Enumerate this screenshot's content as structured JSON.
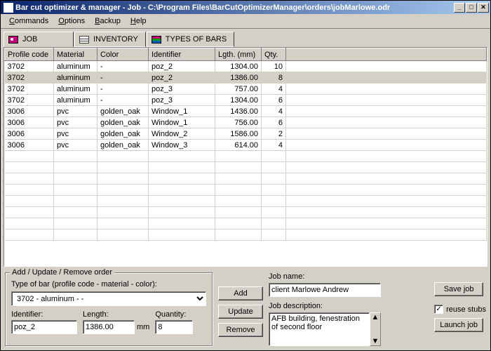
{
  "window": {
    "title": "Bar cut optimizer & manager - Job - C:\\Program Files\\BarCutOptimizerManager\\orders\\jobMarlowe.odr"
  },
  "menu": {
    "commands": "Commands",
    "options": "Options",
    "backup": "Backup",
    "help": "Help"
  },
  "tabs": {
    "job": "JOB",
    "inventory": "INVENTORY",
    "types": "TYPES OF BARS"
  },
  "grid": {
    "headers": {
      "profile": "Profile code",
      "material": "Material",
      "color": "Color",
      "identifier": "Identifier",
      "length": "Lgth. (mm)",
      "qty": "Qty."
    },
    "rows": [
      {
        "profile": "3702",
        "material": "aluminum",
        "color": "-",
        "identifier": "poz_2",
        "length": "1304.00",
        "qty": "10",
        "selected": false
      },
      {
        "profile": "3702",
        "material": "aluminum",
        "color": "-",
        "identifier": "poz_2",
        "length": "1386.00",
        "qty": "8",
        "selected": true
      },
      {
        "profile": "3702",
        "material": "aluminum",
        "color": "-",
        "identifier": "poz_3",
        "length": "757.00",
        "qty": "4",
        "selected": false
      },
      {
        "profile": "3702",
        "material": "aluminum",
        "color": "-",
        "identifier": "poz_3",
        "length": "1304.00",
        "qty": "6",
        "selected": false
      },
      {
        "profile": "3006",
        "material": "pvc",
        "color": "golden_oak",
        "identifier": "Window_1",
        "length": "1436.00",
        "qty": "4",
        "selected": false
      },
      {
        "profile": "3006",
        "material": "pvc",
        "color": "golden_oak",
        "identifier": "Window_1",
        "length": "756.00",
        "qty": "6",
        "selected": false
      },
      {
        "profile": "3006",
        "material": "pvc",
        "color": "golden_oak",
        "identifier": "Window_2",
        "length": "1586.00",
        "qty": "2",
        "selected": false
      },
      {
        "profile": "3006",
        "material": "pvc",
        "color": "golden_oak",
        "identifier": "Window_3",
        "length": "614.00",
        "qty": "4",
        "selected": false
      }
    ]
  },
  "form": {
    "group_title": "Add / Update / Remove order",
    "type_label": "Type of bar (profile code - material -  color):",
    "type_value": "3702 - aluminum - -",
    "identifier_label": "Identifier:",
    "identifier_value": "poz_2",
    "length_label": "Length:",
    "length_value": "1386.00",
    "length_unit": "mm",
    "quantity_label": "Quantity:",
    "quantity_value": "8",
    "add": "Add",
    "update": "Update",
    "remove": "Remove"
  },
  "job": {
    "name_label": "Job name:",
    "name_value": "client Marlowe Andrew",
    "desc_label": "Job description:",
    "desc_value": "AFB building, fenestration of second floor",
    "save": "Save job",
    "reuse": "reuse stubs",
    "launch": "Launch job"
  }
}
